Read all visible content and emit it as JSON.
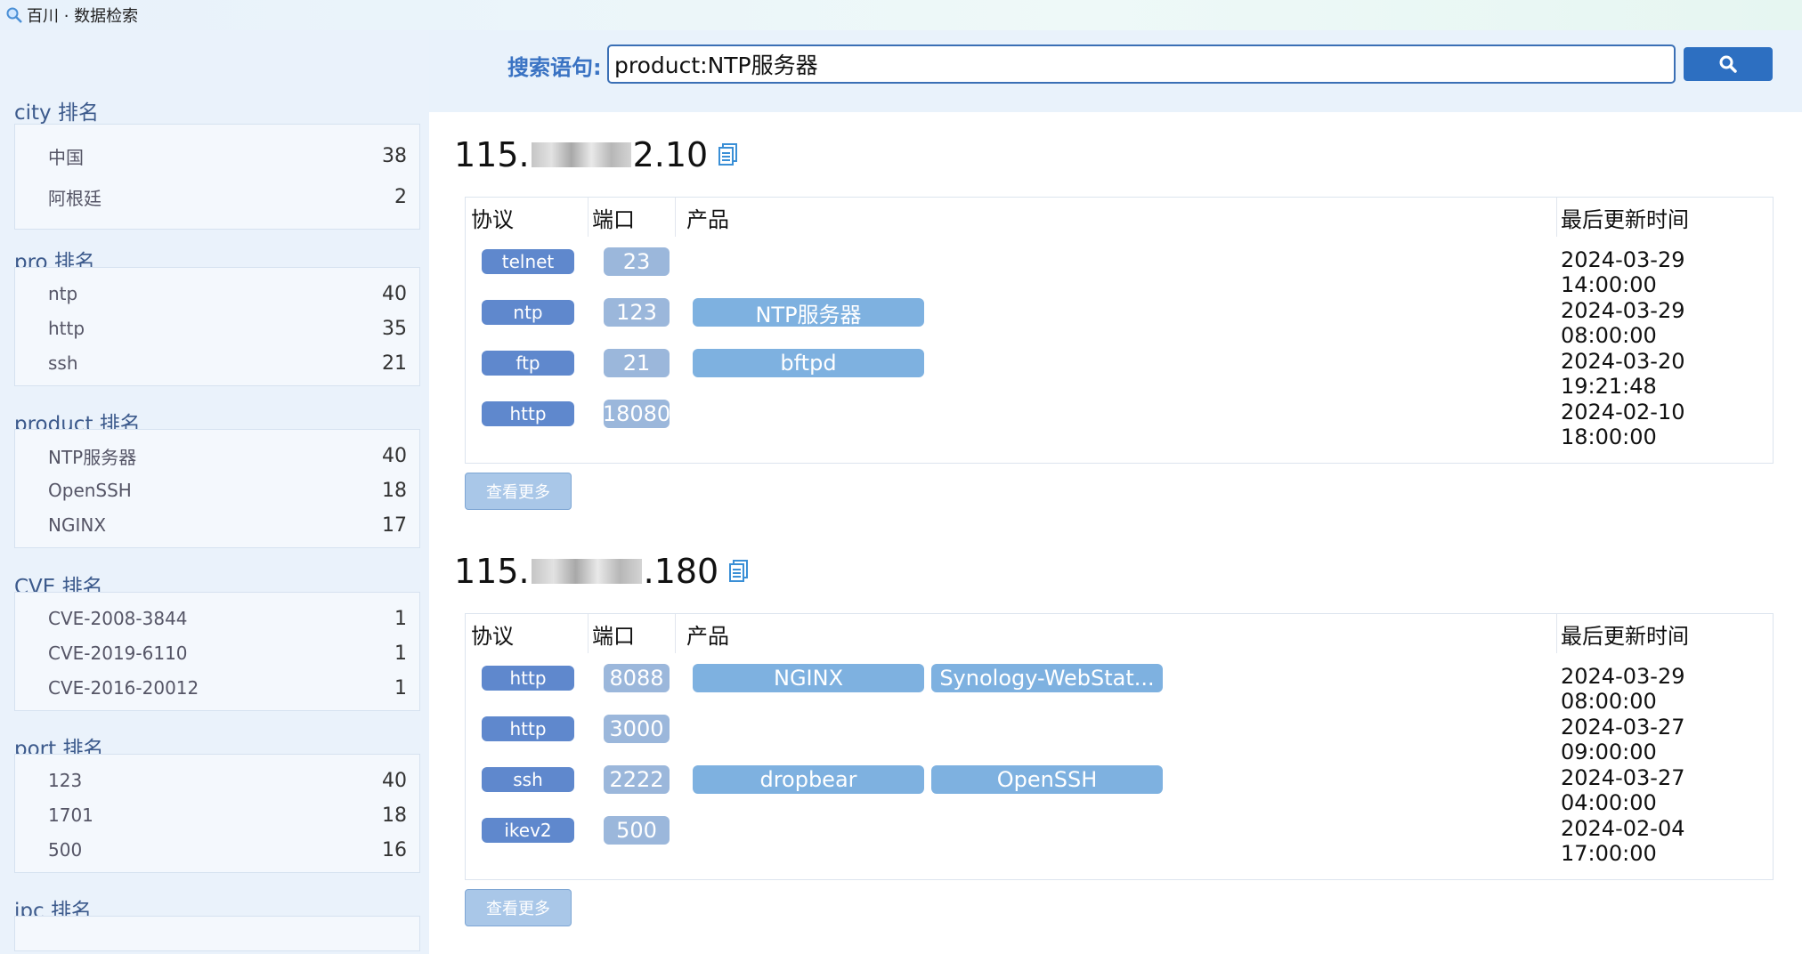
{
  "app": {
    "title": "百川 · 数据检索"
  },
  "search": {
    "label": "搜索语句:",
    "value": "product:NTP服务器"
  },
  "facets": [
    {
      "title": "city 排名",
      "items": [
        {
          "name": "中国",
          "count": "38"
        },
        {
          "name": "阿根廷",
          "count": "2"
        }
      ]
    },
    {
      "title": "pro 排名",
      "items": [
        {
          "name": "ntp",
          "count": "40"
        },
        {
          "name": "http",
          "count": "35"
        },
        {
          "name": "ssh",
          "count": "21"
        }
      ]
    },
    {
      "title": "product 排名",
      "items": [
        {
          "name": "NTP服务器",
          "count": "40"
        },
        {
          "name": "OpenSSH",
          "count": "18"
        },
        {
          "name": "NGINX",
          "count": "17"
        }
      ]
    },
    {
      "title": "CVE 排名",
      "items": [
        {
          "name": "CVE-2008-3844",
          "count": "1"
        },
        {
          "name": "CVE-2019-6110",
          "count": "1"
        },
        {
          "name": "CVE-2016-20012",
          "count": "1"
        }
      ]
    },
    {
      "title": "port 排名",
      "items": [
        {
          "name": "123",
          "count": "40"
        },
        {
          "name": "1701",
          "count": "18"
        },
        {
          "name": "500",
          "count": "16"
        }
      ]
    },
    {
      "title": "ipc 排名",
      "items": []
    }
  ],
  "table_headers": {
    "protocol": "协议",
    "port": "端口",
    "product": "产品",
    "updated": "最后更新时间"
  },
  "more_label": "查看更多",
  "hosts": [
    {
      "ip_prefix": "115.",
      "ip_suffix": "2.10",
      "rows": [
        {
          "protocol": "telnet",
          "port": "23",
          "products": [],
          "updated": "2024-03-29 14:00:00"
        },
        {
          "protocol": "ntp",
          "port": "123",
          "products": [
            "NTP服务器"
          ],
          "updated": "2024-03-29 08:00:00"
        },
        {
          "protocol": "ftp",
          "port": "21",
          "products": [
            "bftpd"
          ],
          "updated": "2024-03-20 19:21:48"
        },
        {
          "protocol": "http",
          "port": "18080",
          "products": [],
          "updated": "2024-02-10 18:00:00"
        }
      ]
    },
    {
      "ip_prefix": "115.",
      "ip_suffix": ".180",
      "rows": [
        {
          "protocol": "http",
          "port": "8088",
          "products": [
            "NGINX",
            "Synology-WebStat..."
          ],
          "updated": "2024-03-29 08:00:00"
        },
        {
          "protocol": "http",
          "port": "3000",
          "products": [],
          "updated": "2024-03-27 09:00:00"
        },
        {
          "protocol": "ssh",
          "port": "2222",
          "products": [
            "dropbear",
            "OpenSSH"
          ],
          "updated": "2024-03-27 04:00:00"
        },
        {
          "protocol": "ikev2",
          "port": "500",
          "products": [],
          "updated": "2024-02-04 17:00:00"
        }
      ]
    }
  ],
  "icons": {
    "app": "magnifier-icon",
    "search_button": "search-icon",
    "copy": "copy-icon"
  },
  "colors": {
    "accent": "#2d6fc1",
    "protocol_pill": "#5f88cd",
    "port_pill": "#9bb7db",
    "product_pill": "#7eb1e0"
  }
}
